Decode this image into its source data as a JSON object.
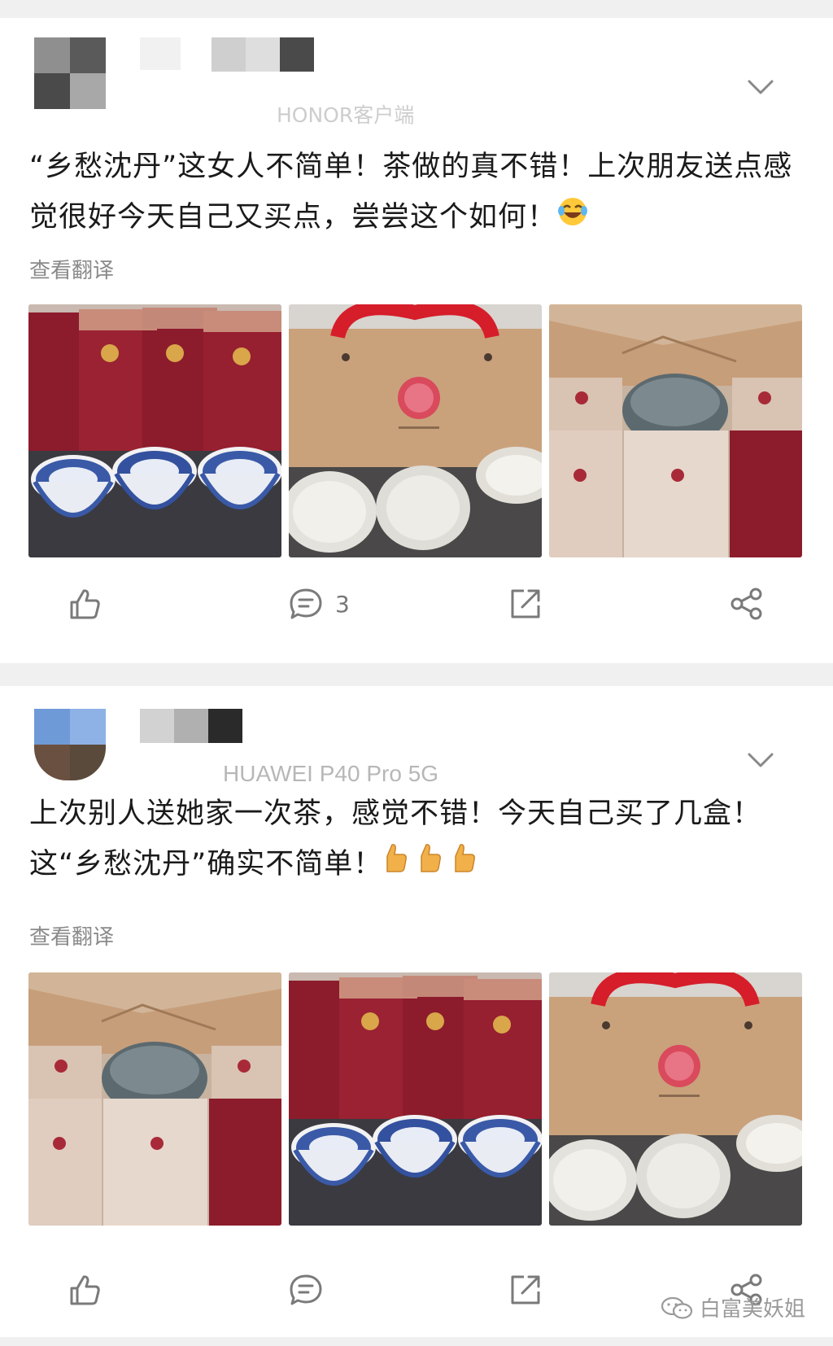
{
  "posts": [
    {
      "source": "HONOR客户端",
      "text": "“乡愁沈丹”这女人不简单！茶做的真不错！上次朋友送点感觉很好今天自己又买点，尝尝这个如何！",
      "emoji": "laughing-tears",
      "translate": "查看翻译",
      "comment_count": "3",
      "photos": [
        "tea-boxes-bowls",
        "gift-bag-tea-cakes",
        "box-set-tea-cake"
      ]
    },
    {
      "source": "HUAWEI P40 Pro 5G",
      "text": "上次别人送她家一次茶，感觉不错！今天自己买了几盒！这“乡愁沈丹”确实不简单！",
      "emoji": "thumbs-up x3",
      "translate": "查看翻译",
      "comment_count": "",
      "photos": [
        "box-set-tea-cake",
        "tea-boxes-bowls",
        "gift-bag-tea-cakes"
      ]
    }
  ],
  "watermark": "白富美妖姐",
  "colors": {
    "text": "#1a1a1a",
    "muted": "#8a8a8a",
    "icon": "#7a7a7a",
    "box_red": "#8c1c2c",
    "kraft": "#c9a27c",
    "bag_red": "#d61d2a",
    "porcelain_blue": "#2f4fa0"
  }
}
